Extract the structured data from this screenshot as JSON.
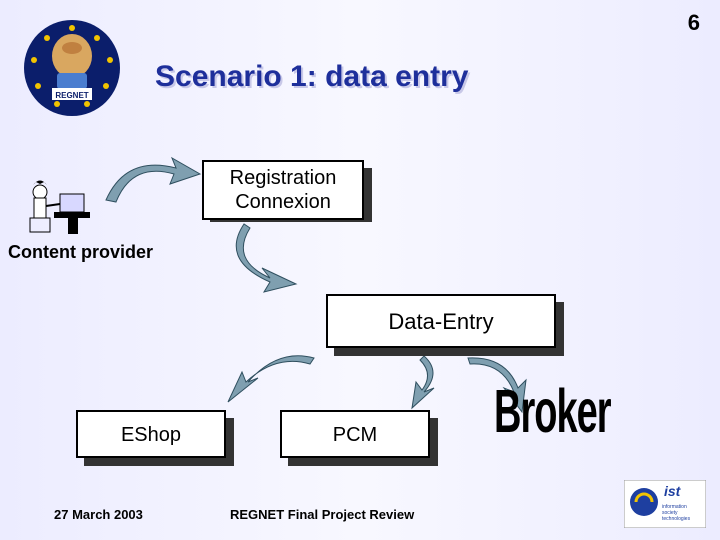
{
  "page_number": "6",
  "title": "Scenario 1: data entry",
  "boxes": {
    "registration": "Registration\nConnexion",
    "data_entry": "Data-Entry",
    "eshop": "EShop",
    "pcm": "PCM"
  },
  "labels": {
    "content_provider": "Content provider",
    "broker": "Broker"
  },
  "footer": {
    "date": "27 March 2003",
    "center": "REGNET Final Project Review"
  },
  "logos": {
    "main": "regnet-logo",
    "ist": "ist-logo"
  }
}
